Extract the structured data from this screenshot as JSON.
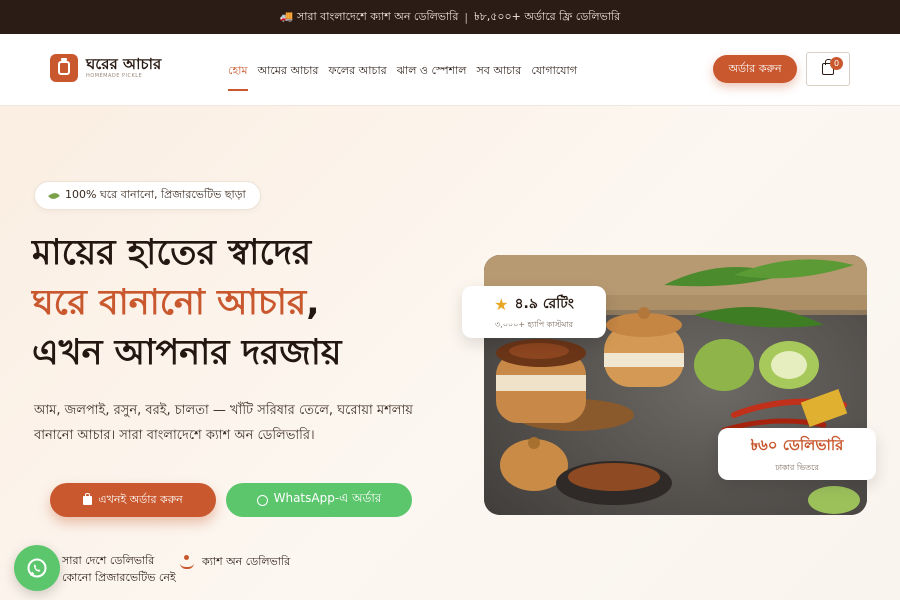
{
  "announcement": {
    "left": "🚚 সারা বাংলাদেশে ক্যাশ অন ডেলিভারি",
    "separator": "|",
    "right": "৳৮,৫০০+ অর্ডারে ফ্রি ডেলিভারি"
  },
  "brand": {
    "name": "ঘরের আচার",
    "subtitle": "HOMEMADE PICKLE"
  },
  "nav": {
    "items": [
      "হোম",
      "আমের আচার",
      "ফলের আচার",
      "ঝাল ও স্পেশাল",
      "সব আচার",
      "যোগাযোগ"
    ],
    "active": "হোম"
  },
  "header": {
    "order_label": "অর্ডার করুন",
    "cart_count": "0"
  },
  "hero": {
    "tagline": "100% ঘরে বানানো, প্রিজারভেটিভ ছাড়া",
    "headline_line1": "মায়ের হাতের স্বাদের",
    "headline_accent": "ঘরে বানানো আচার",
    "headline_comma": ",",
    "headline_line3": "এখন আপনার দরজায়",
    "description": "আম, জলপাই, রসুন, বরই, চালতা — খাঁটি সরিষার তেলে, ঘরোয়া মশলায় বানানো আচার। সারা বাংলাদেশে ক্যাশ অন ডেলিভারি।",
    "cta_primary": "এখনই অর্ডার করুন",
    "cta_whatsapp": "WhatsApp-এ অর্ডার"
  },
  "features": {
    "item1_line1": "সারা দেশে ডেলিভারি",
    "item1_line2": "কোনো প্রিজারভেটিভ নেই",
    "item2": "ক্যাশ অন ডেলিভারি"
  },
  "rating_card": {
    "value": "৪.৯ রেটিং",
    "caption": "৩,০০০+ হ্যাপি কাস্টমার"
  },
  "delivery_card": {
    "value": "৳৬০ ডেলিভারি",
    "caption": "ঢাকার ভিতরে"
  },
  "colors": {
    "accent": "#c9582e",
    "dark": "#2b1d16",
    "whatsapp": "#5cc66d",
    "background": "#fbf5ef"
  }
}
